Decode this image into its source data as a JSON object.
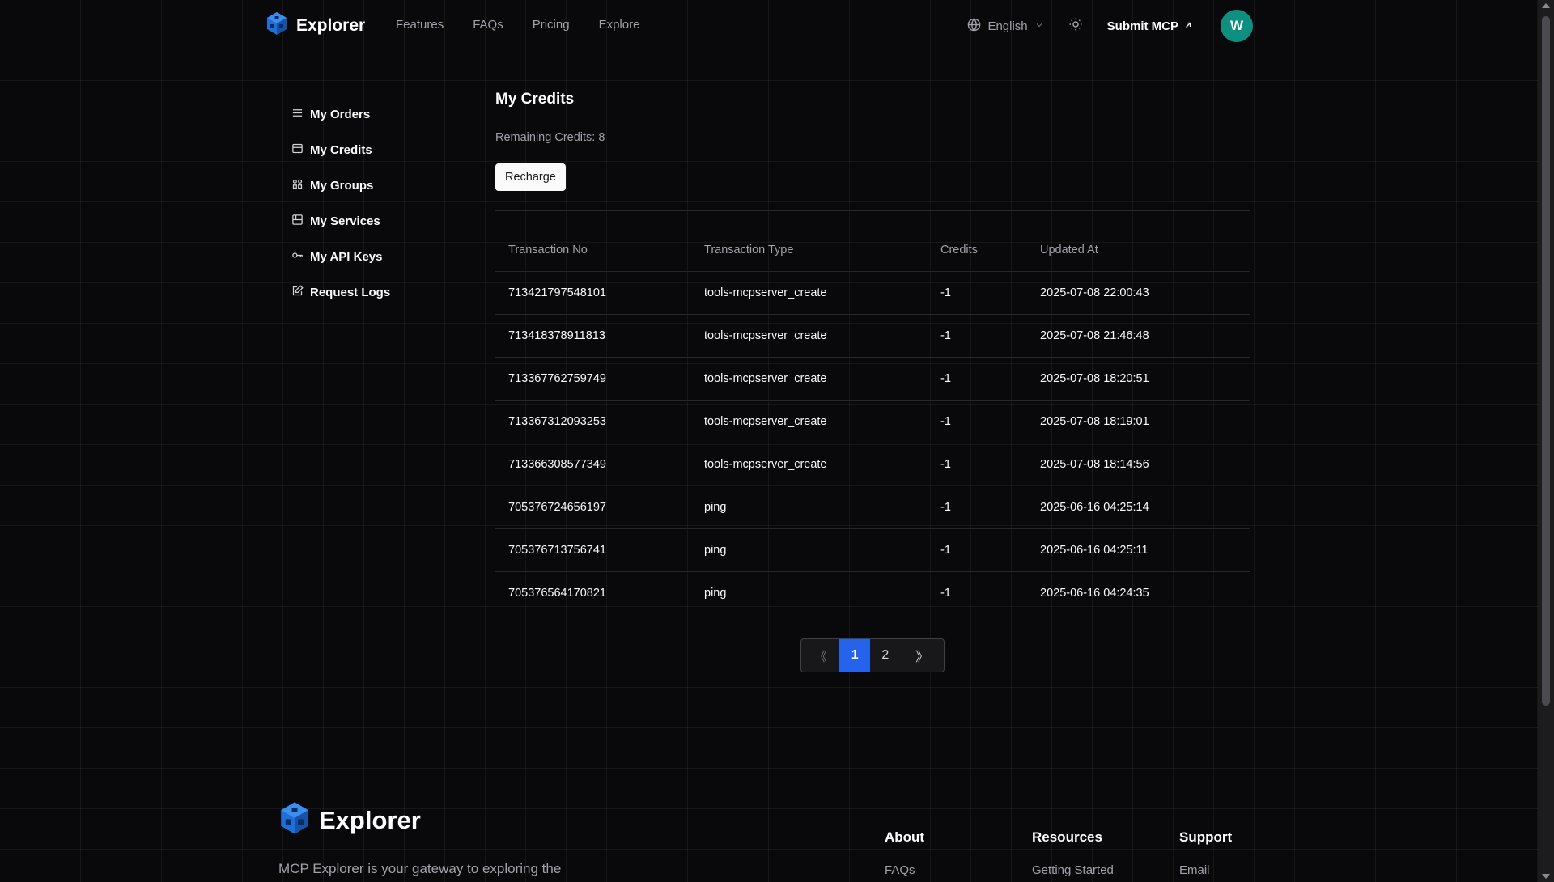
{
  "header": {
    "brand": "Explorer",
    "nav": [
      "Features",
      "FAQs",
      "Pricing",
      "Explore"
    ],
    "language": "English",
    "submit_label": "Submit MCP",
    "avatar_letter": "W"
  },
  "sidebar": {
    "items": [
      {
        "label": "My Orders",
        "icon": "list-icon"
      },
      {
        "label": "My Credits",
        "icon": "credit-card-icon"
      },
      {
        "label": "My Groups",
        "icon": "groups-icon"
      },
      {
        "label": "My Services",
        "icon": "services-icon"
      },
      {
        "label": "My API Keys",
        "icon": "key-icon"
      },
      {
        "label": "Request Logs",
        "icon": "log-edit-icon"
      }
    ]
  },
  "main": {
    "title": "My Credits",
    "remaining": "Remaining Credits: 8",
    "recharge_label": "Recharge",
    "table": {
      "columns": [
        "Transaction No",
        "Transaction Type",
        "Credits",
        "Updated At"
      ],
      "rows": [
        [
          "713421797548101",
          "tools-mcpserver_create",
          "-1",
          "2025-07-08 22:00:43"
        ],
        [
          "713418378911813",
          "tools-mcpserver_create",
          "-1",
          "2025-07-08 21:46:48"
        ],
        [
          "713367762759749",
          "tools-mcpserver_create",
          "-1",
          "2025-07-08 18:20:51"
        ],
        [
          "713367312093253",
          "tools-mcpserver_create",
          "-1",
          "2025-07-08 18:19:01"
        ],
        [
          "713366308577349",
          "tools-mcpserver_create",
          "-1",
          "2025-07-08 18:14:56"
        ],
        [
          "705376724656197",
          "ping",
          "-1",
          "2025-06-16 04:25:14"
        ],
        [
          "705376713756741",
          "ping",
          "-1",
          "2025-06-16 04:25:11"
        ],
        [
          "705376564170821",
          "ping",
          "-1",
          "2025-06-16 04:24:35"
        ]
      ]
    },
    "pagination": {
      "prev": "《",
      "pages": [
        "1",
        "2"
      ],
      "current": "1",
      "next": "》"
    }
  },
  "footer": {
    "brand": "Explorer",
    "description": "MCP Explorer is your gateway to exploring the",
    "columns": [
      {
        "heading": "About",
        "link": "FAQs"
      },
      {
        "heading": "Resources",
        "link": "Getting Started"
      },
      {
        "heading": "Support",
        "link": "Email"
      }
    ]
  },
  "colors": {
    "background": "#09090b",
    "accent": "#2563eb",
    "avatar": "#0f8f7f",
    "logo_blue": "#1e6fd9"
  }
}
